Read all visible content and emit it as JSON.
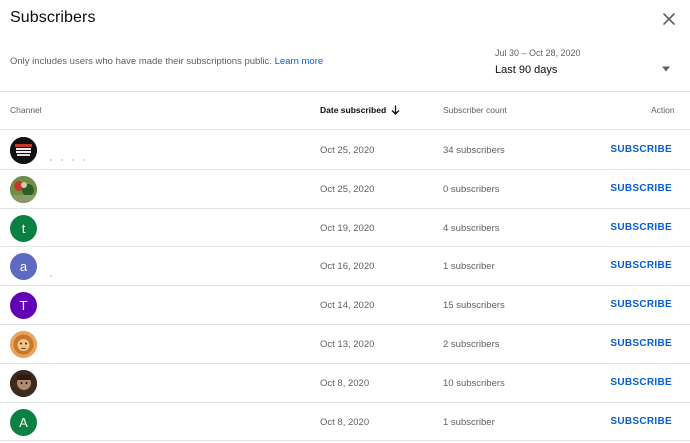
{
  "dialog": {
    "title": "Subscribers",
    "notice_text": "Only includes users who have made their subscriptions public. ",
    "learn_more": "Learn more",
    "date_range": {
      "dates": "Jul 30 – Oct 28, 2020",
      "label": "Last 90 days"
    }
  },
  "table": {
    "headers": {
      "channel": "Channel",
      "date": "Date subscribed",
      "count": "Subscriber count",
      "action": "Action"
    },
    "rows": [
      {
        "avatar": "image",
        "avatar_color": "#1a1a1a",
        "date": "Oct 25, 2020",
        "count": "34 subscribers",
        "action": "SUBSCRIBE"
      },
      {
        "avatar": "image",
        "avatar_color": "#5a7a3a",
        "date": "Oct 25, 2020",
        "count": "0 subscribers",
        "action": "SUBSCRIBE"
      },
      {
        "avatar": "t",
        "avatar_color": "#0b8043",
        "date": "Oct 19, 2020",
        "count": "4 subscribers",
        "action": "SUBSCRIBE"
      },
      {
        "avatar": "a",
        "avatar_color": "#5c6bc0",
        "date": "Oct 16, 2020",
        "count": "1 subscriber",
        "action": "SUBSCRIBE"
      },
      {
        "avatar": "T",
        "avatar_color": "#6200b3",
        "date": "Oct 14, 2020",
        "count": "15 subscribers",
        "action": "SUBSCRIBE"
      },
      {
        "avatar": "image",
        "avatar_color": "#d98a3a",
        "date": "Oct 13, 2020",
        "count": "2 subscribers",
        "action": "SUBSCRIBE"
      },
      {
        "avatar": "image",
        "avatar_color": "#5a4030",
        "date": "Oct 8, 2020",
        "count": "10 subscribers",
        "action": "SUBSCRIBE"
      },
      {
        "avatar": "A",
        "avatar_color": "#0b8043",
        "date": "Oct 8, 2020",
        "count": "1 subscriber",
        "action": "SUBSCRIBE"
      }
    ]
  },
  "colors": {
    "accent": "#065fd4",
    "divider": "#e5e5e5",
    "secondary_text": "#606060"
  },
  "icons": {
    "close": "close-icon",
    "dropdown": "caret-down-icon",
    "sort": "arrow-down-icon"
  }
}
